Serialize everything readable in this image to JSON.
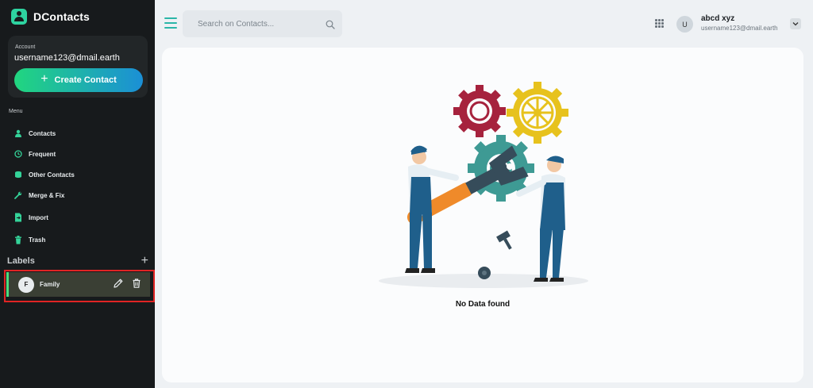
{
  "app": {
    "name": "DContacts"
  },
  "account": {
    "caption": "Account",
    "email": "username123@dmail.earth",
    "create_label": "Create Contact"
  },
  "menu": {
    "caption": "Menu",
    "items": [
      {
        "label": "Contacts",
        "icon": "person-icon"
      },
      {
        "label": "Frequent",
        "icon": "history-icon"
      },
      {
        "label": "Other Contacts",
        "icon": "database-icon"
      },
      {
        "label": "Merge & Fix",
        "icon": "wrench-icon"
      },
      {
        "label": "Import",
        "icon": "file-import-icon"
      },
      {
        "label": "Trash",
        "icon": "trash-icon"
      }
    ]
  },
  "labels": {
    "title": "Labels",
    "items": [
      {
        "initial": "F",
        "name": "Family"
      }
    ]
  },
  "header": {
    "search_placeholder": "Search on Contacts...",
    "user": {
      "initial": "U",
      "name": "abcd xyz",
      "email": "username123@dmail.earth"
    }
  },
  "main": {
    "empty_text": "No Data found"
  },
  "colors": {
    "accent": "#2bb6a8",
    "sidebar_bg": "#171a1c",
    "highlight": "#e02424",
    "gradient_start": "#21d67f",
    "gradient_end": "#1b8fd6"
  }
}
